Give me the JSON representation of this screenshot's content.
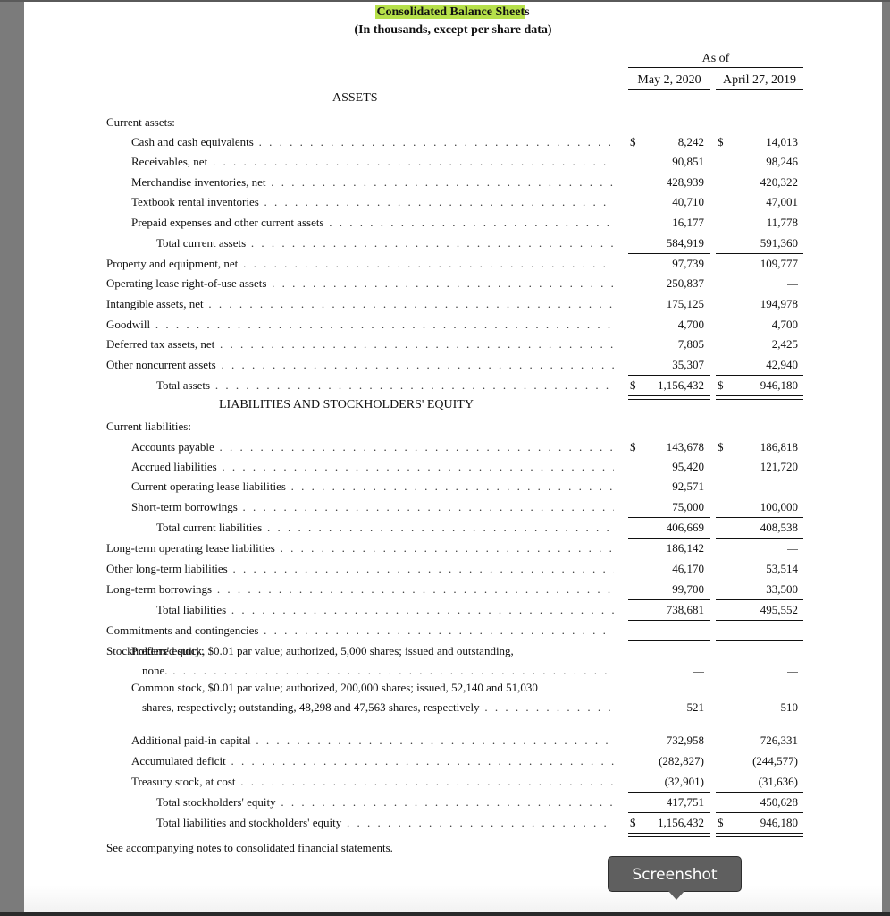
{
  "document": {
    "title": "Consolidated Balance Sheets",
    "subtitle": "(In thousands, except per share data)",
    "as_of_label": "As of",
    "columns": [
      "May 2, 2020",
      "April 27, 2019"
    ],
    "highlight_color": "#b6e04a",
    "sections": {
      "assets": "ASSETS",
      "liabilities_equity": "LIABILITIES AND STOCKHOLDERS' EQUITY"
    },
    "rows": [
      {
        "label": "Current assets:",
        "indent": 0,
        "dots": false,
        "v1": "",
        "v2": ""
      },
      {
        "label": "Cash and cash equivalents",
        "indent": 1,
        "dots": true,
        "dollar": true,
        "v1": "8,242",
        "v2": "14,013"
      },
      {
        "label": "Receivables, net",
        "indent": 1,
        "dots": true,
        "v1": "90,851",
        "v2": "98,246"
      },
      {
        "label": "Merchandise inventories, net",
        "indent": 1,
        "dots": true,
        "v1": "428,939",
        "v2": "420,322"
      },
      {
        "label": "Textbook rental inventories",
        "indent": 1,
        "dots": true,
        "v1": "40,710",
        "v2": "47,001"
      },
      {
        "label": "Prepaid expenses and other current assets",
        "indent": 1,
        "dots": true,
        "v1": "16,177",
        "v2": "11,778",
        "line_after": true
      },
      {
        "label": "Total current assets",
        "indent": 2,
        "dots": true,
        "v1": "584,919",
        "v2": "591,360",
        "line_after": true
      },
      {
        "label": "Property and equipment, net",
        "indent": 0,
        "dots": true,
        "v1": "97,739",
        "v2": "109,777"
      },
      {
        "label": "Operating lease right-of-use assets",
        "indent": 0,
        "dots": true,
        "v1": "250,837",
        "v2": "—"
      },
      {
        "label": "Intangible assets, net",
        "indent": 0,
        "dots": true,
        "v1": "175,125",
        "v2": "194,978"
      },
      {
        "label": "Goodwill",
        "indent": 0,
        "dots": true,
        "v1": "4,700",
        "v2": "4,700"
      },
      {
        "label": "Deferred tax assets, net",
        "indent": 0,
        "dots": true,
        "v1": "7,805",
        "v2": "2,425"
      },
      {
        "label": "Other noncurrent assets",
        "indent": 0,
        "dots": true,
        "v1": "35,307",
        "v2": "42,940",
        "line_after": true
      },
      {
        "label": "Total assets",
        "indent": 2,
        "dots": true,
        "dollar": true,
        "v1": "1,156,432",
        "v2": "946,180",
        "double_after": true
      },
      {
        "section": "liabilities_equity"
      },
      {
        "label": "Current liabilities:",
        "indent": 0,
        "dots": false,
        "v1": "",
        "v2": ""
      },
      {
        "label": "Accounts payable",
        "indent": 1,
        "dots": true,
        "dollar": true,
        "v1": "143,678",
        "v2": "186,818"
      },
      {
        "label": "Accrued liabilities",
        "indent": 1,
        "dots": true,
        "v1": "95,420",
        "v2": "121,720"
      },
      {
        "label": "Current operating lease liabilities",
        "indent": 1,
        "dots": true,
        "v1": "92,571",
        "v2": "—"
      },
      {
        "label": "Short-term borrowings",
        "indent": 1,
        "dots": true,
        "v1": "75,000",
        "v2": "100,000",
        "line_after": true
      },
      {
        "label": "Total current liabilities",
        "indent": 2,
        "dots": true,
        "v1": "406,669",
        "v2": "408,538",
        "line_after": true
      },
      {
        "label": "Long-term operating lease liabilities",
        "indent": 0,
        "dots": true,
        "v1": "186,142",
        "v2": "—"
      },
      {
        "label": "Other long-term liabilities",
        "indent": 0,
        "dots": true,
        "v1": "46,170",
        "v2": "53,514"
      },
      {
        "label": "Long-term borrowings",
        "indent": 0,
        "dots": true,
        "v1": "99,700",
        "v2": "33,500",
        "line_after": true
      },
      {
        "label": "Total liabilities",
        "indent": 2,
        "dots": true,
        "v1": "738,681",
        "v2": "495,552",
        "line_after": true
      },
      {
        "label": "Commitments and contingencies",
        "indent": 0,
        "dots": true,
        "v1": "—",
        "v2": "—",
        "line_after": true
      },
      {
        "label": "Stockholders' equity:",
        "indent": 0,
        "dots": false,
        "v1": "",
        "v2": ""
      },
      {
        "label": "Preferred stock, $0.01 par value; authorized, 5,000 shares; issued and outstanding,",
        "label2": "none.",
        "indent": 1,
        "dots": true,
        "v1": "—",
        "v2": "—"
      },
      {
        "label": "Common stock, $0.01 par value; authorized, 200,000 shares; issued, 52,140 and 51,030",
        "label2": "shares, respectively; outstanding, 48,298 and 47,563 shares, respectively",
        "indent": 1,
        "dots": true,
        "v1": "521",
        "v2": "510"
      },
      {
        "label": "Additional paid-in capital",
        "indent": 1,
        "dots": true,
        "v1": "732,958",
        "v2": "726,331"
      },
      {
        "label": "Accumulated deficit",
        "indent": 1,
        "dots": true,
        "v1": "(282,827)",
        "v2": "(244,577)"
      },
      {
        "label": "Treasury stock, at cost",
        "indent": 1,
        "dots": true,
        "v1": "(32,901)",
        "v2": "(31,636)",
        "line_after": true
      },
      {
        "label": "Total stockholders' equity",
        "indent": 2,
        "dots": true,
        "v1": "417,751",
        "v2": "450,628",
        "line_after": true
      },
      {
        "label": "Total liabilities and stockholders' equity",
        "indent": 2,
        "dots": true,
        "dollar": true,
        "v1": "1,156,432",
        "v2": "946,180",
        "double_after": true
      }
    ],
    "footnote": "See accompanying notes to consolidated financial statements."
  },
  "tooltip": {
    "label": "Screenshot"
  },
  "currency_symbol": "$"
}
